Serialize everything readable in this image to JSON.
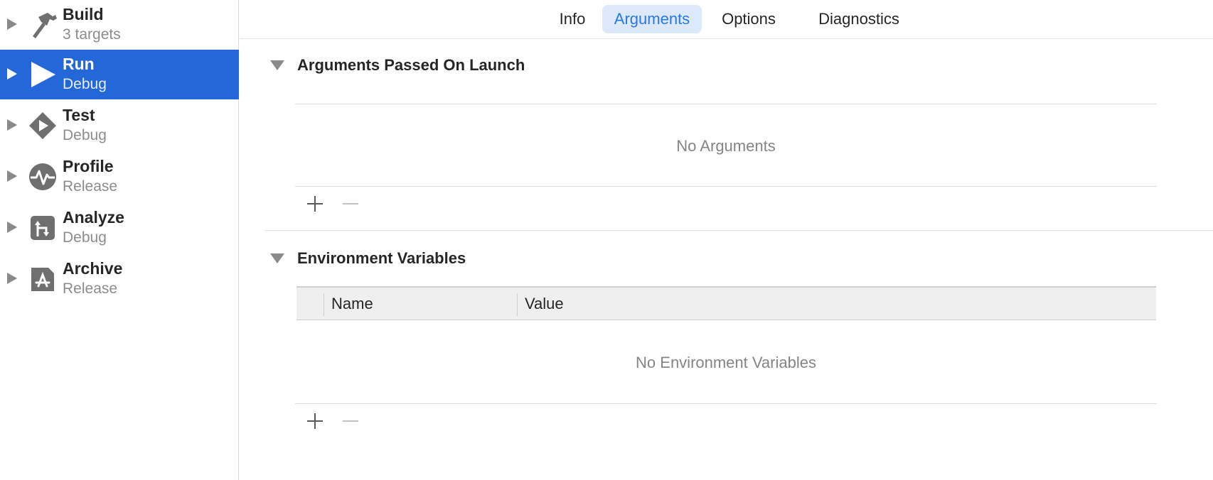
{
  "sidebar": {
    "items": [
      {
        "name": "Build",
        "sub": "3 targets",
        "icon": "hammer-icon"
      },
      {
        "name": "Run",
        "sub": "Debug",
        "icon": "play-icon",
        "selected": true
      },
      {
        "name": "Test",
        "sub": "Debug",
        "icon": "test-diamond-icon"
      },
      {
        "name": "Profile",
        "sub": "Release",
        "icon": "activity-pulse-icon"
      },
      {
        "name": "Analyze",
        "sub": "Debug",
        "icon": "analyze-icon"
      },
      {
        "name": "Archive",
        "sub": "Release",
        "icon": "archive-appstore-icon"
      }
    ]
  },
  "tabs": [
    {
      "label": "Info"
    },
    {
      "label": "Arguments",
      "active": true
    },
    {
      "label": "Options"
    },
    {
      "label": "Diagnostics"
    }
  ],
  "arguments_section": {
    "title": "Arguments Passed On Launch",
    "empty_message": "No Arguments"
  },
  "env_section": {
    "title": "Environment Variables",
    "col_name": "Name",
    "col_value": "Value",
    "empty_message": "No Environment Variables"
  },
  "colors": {
    "selection": "#2367d9",
    "active_tab_bg": "#dbe9fb",
    "active_tab_text": "#2a78e4"
  }
}
